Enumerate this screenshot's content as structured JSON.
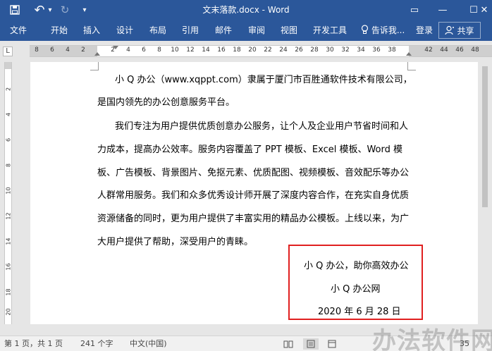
{
  "titlebar": {
    "title": "文末落款.docx - Word",
    "save_icon": "save-icon",
    "undo_glyph": "↶",
    "undo_dropdown": "▾",
    "redo_glyph": "↻",
    "customize_glyph": "▾",
    "ribbon_display_glyph": "▭",
    "minimize_glyph": "—",
    "maximize_glyph": "☐",
    "close_glyph": "✕"
  },
  "ribbon": {
    "tabs": [
      "文件",
      "开始",
      "插入",
      "设计",
      "布局",
      "引用",
      "邮件",
      "审阅",
      "视图",
      "开发工具"
    ],
    "tell_me": "告诉我...",
    "sign_in": "登录",
    "share": "共享",
    "tell_me_icon": "lightbulb-icon",
    "share_icon": "person-icon"
  },
  "ruler": {
    "corner": "L",
    "h_ticks": [
      "8",
      "6",
      "4",
      "2",
      "2",
      "4",
      "6",
      "8",
      "10",
      "12",
      "14",
      "16",
      "18",
      "20",
      "22",
      "24",
      "26",
      "28",
      "30",
      "32",
      "34",
      "36",
      "38",
      "42",
      "44",
      "46",
      "48"
    ],
    "v_ticks": [
      "2",
      "4",
      "6",
      "8",
      "10",
      "12",
      "14",
      "16",
      "18",
      "20"
    ]
  },
  "document": {
    "paragraph_lines": [
      "小 Q 办公（www.xqppt.com）隶属于厦门市百胜通软件技术有限公司，",
      "是国内领先的办公创意服务平台。",
      "我们专注为用户提供优质创意办公服务，让个人及企业用户节省时间和人",
      "力成本，提高办公效率。服务内容覆盖了 PPT 模板、Excel 模板、Word 模",
      "板、广告模板、背景图片、免抠元素、优质配图、视频模板、音效配乐等办公",
      "人群常用服务。我们和众多优秀设计师开展了深度内容合作，在充实自身优质",
      "资源储备的同时，更为用户提供了丰富实用的精品办公模板。上线以来，为广",
      "大用户提供了帮助，深受用户的青睐。"
    ],
    "signature": {
      "slogan": "小 Q 办公，助你高效办公",
      "site": "小 Q 办公网",
      "date": "2020 年 6 月 28 日"
    },
    "highlight_color": "#e02020"
  },
  "statusbar": {
    "page": "第 1 页，共 1 页",
    "words": "241 个字",
    "language": "中文(中国)",
    "zoom_partial": "35"
  },
  "watermark": "办法软件网",
  "colors": {
    "accent": "#2b579a"
  }
}
